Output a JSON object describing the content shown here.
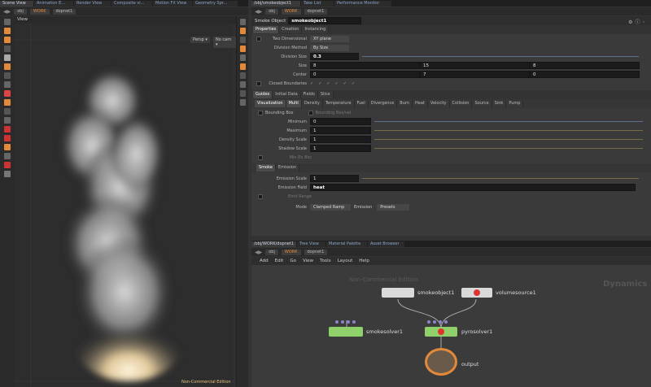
{
  "top_tabs_left": [
    "Scene View",
    "Animation E...",
    "Render View",
    "Composite vi...",
    "Motion FX View",
    "Geometry Spr..."
  ],
  "top_tabs_right": [
    "/obj/smokeobject1",
    "Take List",
    "Performance Monitor"
  ],
  "left_path": {
    "obj": "obj",
    "net": "WORK",
    "node": "dopnet1"
  },
  "right_path": {
    "obj": "obj",
    "net": "WORK",
    "node": "dopnet1"
  },
  "viewport": {
    "label": "View",
    "persp": "Persp ▾",
    "cam": "No cam ▾",
    "watermark": "Non-Commercial Edition"
  },
  "params": {
    "node_type": "Smoke Object",
    "node_name": "smokeobject1",
    "top_tabs": [
      "Properties",
      "Creation",
      "Instancing"
    ],
    "two_dim_label": "Two Dimensional",
    "two_dim_value": "XY plane",
    "div_method_label": "Division Method",
    "div_method_value": "By Size",
    "div_size_label": "Division Size",
    "div_size_value": "0.3",
    "size_label": "Size",
    "size_values": [
      "8",
      "15",
      "8"
    ],
    "center_label": "Center",
    "center_values": [
      "0",
      "7",
      "0"
    ],
    "closed_label": "Closed Boundaries",
    "sec_tabs": [
      "Guides",
      "Initial Data",
      "Fields",
      "Slice"
    ],
    "vis_tabs": [
      "Visualization",
      "Multi",
      "Density",
      "Temperature",
      "Fuel",
      "Divergence",
      "Burn",
      "Heat",
      "Velocity",
      "Collision",
      "Source",
      "Sink",
      "Pump"
    ],
    "bbox_label": "Bounding Box",
    "bbox2_label": "Bounding Box/vel",
    "min_label": "Minimum",
    "min_value": "0",
    "max_label": "Maximum",
    "max_value": "1",
    "dscale_label": "Density Scale",
    "dscale_value": "1",
    "shscale_label": "Shadow Scale",
    "shscale_value": "1",
    "minrgb_label": "Min Rx Bsc",
    "smoke_tabs": [
      "Smoke",
      "Emission"
    ],
    "emscale_label": "Emission Scale",
    "emscale_value": "1",
    "emfield_label": "Emission Field",
    "emfield_value": "heat",
    "emrange_label": "Emit Range",
    "mode_label": "Mode",
    "mode_value": "Clamped Ramp",
    "emission_label": "Emission",
    "presets_label": "Presets"
  },
  "net_tabs": [
    "/obj/WORK/dopnet1",
    "Tree View",
    "Material Palette",
    "Asset Browser"
  ],
  "net_menu": [
    "Add",
    "Edit",
    "Go",
    "View",
    "Tools",
    "Layout",
    "Help"
  ],
  "network": {
    "context": "Dynamics",
    "watermark": "Non-Commercial Edition",
    "nodes": {
      "smokeobject": "smokeobject1",
      "volumesource": "volumesource1",
      "smokesolver": "smokesolver1",
      "pyrosolver": "pyrosolver1",
      "output": "output"
    }
  },
  "colors": {
    "accent": "#e38a3a",
    "solver": "#8fd06a",
    "object": "#d9d9d9",
    "output": "#6a5a4a",
    "link": "#8aa4c8"
  }
}
